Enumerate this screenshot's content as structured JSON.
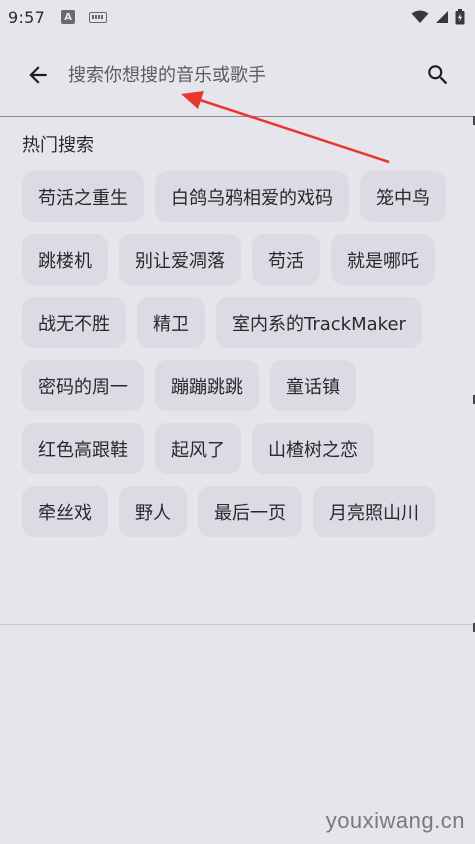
{
  "status_bar": {
    "time": "9:57",
    "a_badge": "A",
    "icons": [
      "a-notification-icon",
      "keyboard-icon",
      "wifi-icon",
      "signal-icon",
      "battery-icon"
    ]
  },
  "search": {
    "placeholder": "搜索你想搜的音乐或歌手",
    "value": ""
  },
  "hot_search": {
    "title": "热门搜索",
    "items": [
      "苟活之重生",
      "白鸽乌鸦相爱的戏码",
      "笼中鸟",
      "跳楼机",
      "别让爱凋落",
      "苟活",
      "就是哪吒",
      "战无不胜",
      "精卫",
      "室内系的TrackMaker",
      "密码的周一",
      "蹦蹦跳跳",
      "童话镇",
      "红色高跟鞋",
      "起风了",
      "山楂树之恋",
      "牵丝戏",
      "野人",
      "最后一页",
      "月亮照山川"
    ]
  },
  "colors": {
    "background": "#e7e5ec",
    "chip": "#dcdae2",
    "annotation_arrow": "#e8382c"
  },
  "watermark": "youxiwang.cn"
}
